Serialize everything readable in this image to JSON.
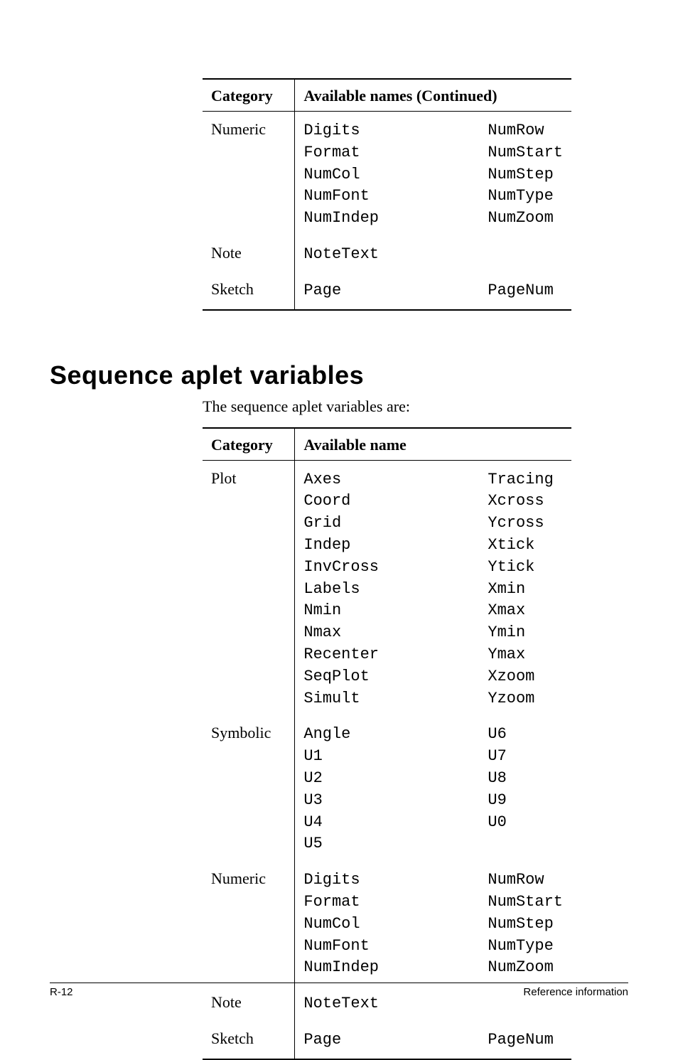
{
  "table1": {
    "header_cat": "Category",
    "header_names": "Available names  (Continued)",
    "rows": [
      {
        "category": "Numeric",
        "col1": [
          "Digits",
          "Format",
          "NumCol",
          "NumFont",
          "NumIndep"
        ],
        "col2": [
          "NumRow",
          "NumStart",
          "NumStep",
          "NumType",
          "NumZoom"
        ]
      },
      {
        "category": "Note",
        "col1": [
          "NoteText"
        ],
        "col2": []
      },
      {
        "category": "Sketch",
        "col1": [
          "Page"
        ],
        "col2": [
          "PageNum"
        ]
      }
    ]
  },
  "heading": "Sequence aplet variables",
  "intro": "The sequence aplet variables are:",
  "table2": {
    "header_cat": "Category",
    "header_names": "Available name",
    "rows": [
      {
        "category": "Plot",
        "col1": [
          "Axes",
          "Coord",
          "Grid",
          "Indep",
          "InvCross",
          "Labels",
          "Nmin",
          "Nmax",
          "Recenter",
          "SeqPlot",
          "Simult"
        ],
        "col2": [
          "Tracing",
          "Xcross",
          "Ycross",
          "Xtick",
          "Ytick",
          "Xmin",
          "Xmax",
          "Ymin",
          "Ymax",
          "Xzoom",
          "Yzoom"
        ]
      },
      {
        "category": "Symbolic",
        "col1": [
          "Angle",
          "U1",
          "U2",
          "U3",
          "U4",
          "U5"
        ],
        "col2": [
          "U6",
          "U7",
          "U8",
          "U9",
          "U0"
        ]
      },
      {
        "category": "Numeric",
        "col1": [
          "Digits",
          "Format",
          "NumCol",
          "NumFont",
          "NumIndep"
        ],
        "col2": [
          "NumRow",
          "NumStart",
          "NumStep",
          "NumType",
          "NumZoom"
        ]
      },
      {
        "category": "Note",
        "col1": [
          "NoteText"
        ],
        "col2": []
      },
      {
        "category": "Sketch",
        "col1": [
          "Page"
        ],
        "col2": [
          "PageNum"
        ]
      }
    ]
  },
  "footer_left": "R-12",
  "footer_right": "Reference information"
}
